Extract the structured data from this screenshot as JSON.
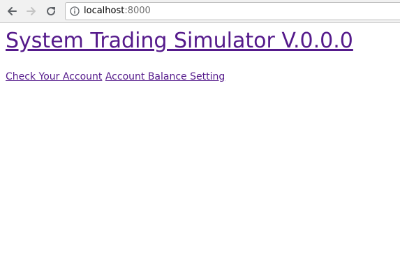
{
  "browser": {
    "url_host": "localhost",
    "url_port": ":8000"
  },
  "page": {
    "title": "System Trading Simulator V.0.0.0",
    "links": [
      {
        "label": "Check Your Account"
      },
      {
        "label": "Account Balance Setting"
      }
    ]
  },
  "colors": {
    "visited_link": "#551a8b",
    "toolbar_bg": "#f1f1f1"
  }
}
